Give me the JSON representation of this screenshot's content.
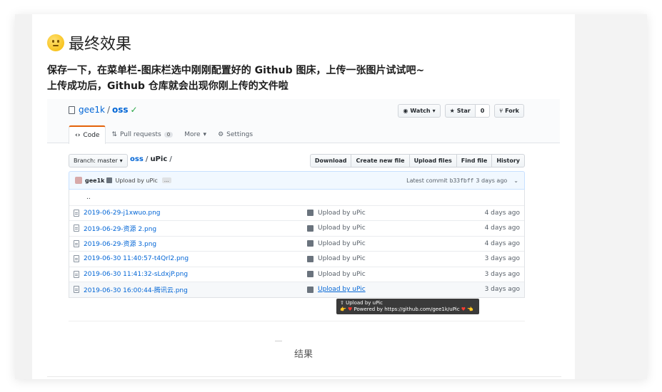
{
  "article": {
    "heading": "最终效果",
    "para1": "保存一下，在菜单栏-图床栏选中刚刚配置好的 Github 图床，上传一张图片试试吧~",
    "para2": "上传成功后，Github 仓库就会出现你刚上传的文件啦",
    "caption": "结果"
  },
  "repo": {
    "owner": "gee1k",
    "name": "oss",
    "buttons": {
      "watch": "Watch",
      "star": "Star",
      "star_count": "0",
      "fork": "Fork"
    },
    "tabs": [
      {
        "label": "Code"
      },
      {
        "label": "Pull requests",
        "badge": "0"
      },
      {
        "label": "More"
      },
      {
        "label": "Settings"
      }
    ],
    "branch": "Branch: master",
    "path": {
      "root": "oss",
      "folder": "uPic"
    },
    "actions": [
      "Download",
      "Create new file",
      "Upload files",
      "Find file",
      "History"
    ],
    "commit": {
      "author": "gee1k",
      "message": "Upload by uPic",
      "ellipsis": "…",
      "latest_label": "Latest commit",
      "sha": "b33fbff",
      "age": "3 days ago"
    },
    "parent_dir": "..",
    "files": [
      {
        "name": "2019-06-29-j1xwuo.png",
        "message": "Upload by uPic",
        "age": "4 days ago"
      },
      {
        "name": "2019-06-29-资源 2.png",
        "message": "Upload by uPic",
        "age": "4 days ago"
      },
      {
        "name": "2019-06-29-资源 3.png",
        "message": "Upload by uPic",
        "age": "4 days ago"
      },
      {
        "name": "2019-06-30 11:40:57-t4Qrl2.png",
        "message": "Upload by uPic",
        "age": "3 days ago"
      },
      {
        "name": "2019-06-30 11:41:32-sLdxjP.png",
        "message": "Upload by uPic",
        "age": "3 days ago"
      },
      {
        "name": "2019-06-30 16:00:44-腾讯云.png",
        "message": "Upload by uPic",
        "age": "3 days ago"
      }
    ],
    "tooltip": {
      "line1": "Upload by uPic",
      "line2": "Powered by https://github.com/gee1k/uPic"
    }
  },
  "colors": {
    "link": "#0366d6",
    "check": "#28a745",
    "tab_accent": "#e36209",
    "commit_bg": "#f1f8ff"
  }
}
